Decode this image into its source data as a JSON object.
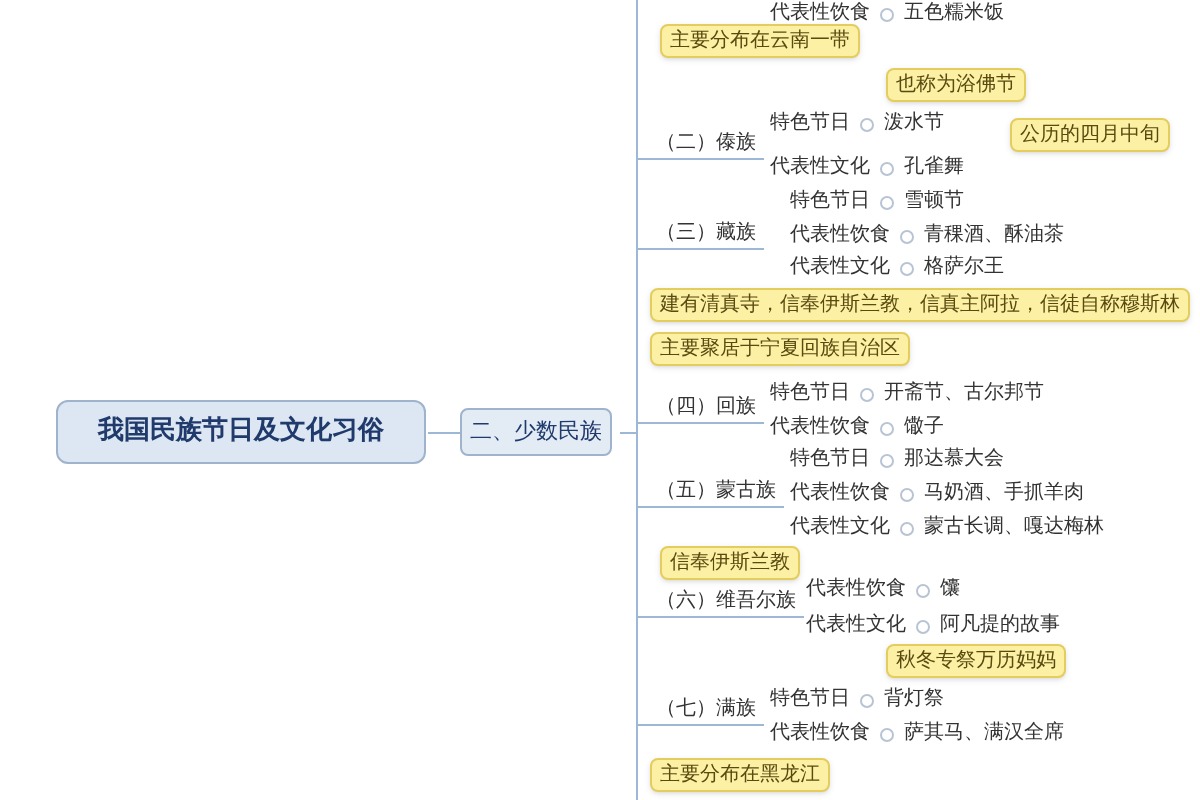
{
  "root": {
    "title": "我国民族节日及文化习俗"
  },
  "branch": {
    "title": "二、少数民族"
  },
  "top_fragment": {
    "label": "代表性饮食",
    "value": "五色糯米饭"
  },
  "groups": [
    {
      "title": "（二）傣族",
      "notes": [
        "主要分布在云南一带"
      ],
      "items": [
        {
          "label": "特色节日",
          "value": "泼水节",
          "notes": [
            "也称为浴佛节",
            "公历的四月中旬"
          ]
        },
        {
          "label": "代表性文化",
          "value": "孔雀舞"
        }
      ]
    },
    {
      "title": "（三）藏族",
      "items": [
        {
          "label": "特色节日",
          "value": "雪顿节"
        },
        {
          "label": "代表性饮食",
          "value": "青稞酒、酥油茶"
        },
        {
          "label": "代表性文化",
          "value": "格萨尔王"
        }
      ]
    },
    {
      "title": "（四）回族",
      "notes": [
        "建有清真寺，信奉伊斯兰教，信真主阿拉，信徒自称穆斯林",
        "主要聚居于宁夏回族自治区"
      ],
      "items": [
        {
          "label": "特色节日",
          "value": "开斋节、古尔邦节"
        },
        {
          "label": "代表性饮食",
          "value": "馓子"
        }
      ]
    },
    {
      "title": "（五）蒙古族",
      "items": [
        {
          "label": "特色节日",
          "value": "那达慕大会"
        },
        {
          "label": "代表性饮食",
          "value": "马奶酒、手抓羊肉"
        },
        {
          "label": "代表性文化",
          "value": "蒙古长调、嘎达梅林"
        }
      ]
    },
    {
      "title": "（六）维吾尔族",
      "notes": [
        "信奉伊斯兰教"
      ],
      "items": [
        {
          "label": "代表性饮食",
          "value": "馕"
        },
        {
          "label": "代表性文化",
          "value": "阿凡提的故事"
        }
      ]
    },
    {
      "title": "（七）满族",
      "notes": [
        "主要分布在黑龙江"
      ],
      "items": [
        {
          "label": "特色节日",
          "value": "背灯祭",
          "notes": [
            "秋冬专祭万历妈妈"
          ]
        },
        {
          "label": "代表性饮食",
          "value": "萨其马、满汉全席"
        }
      ]
    }
  ]
}
